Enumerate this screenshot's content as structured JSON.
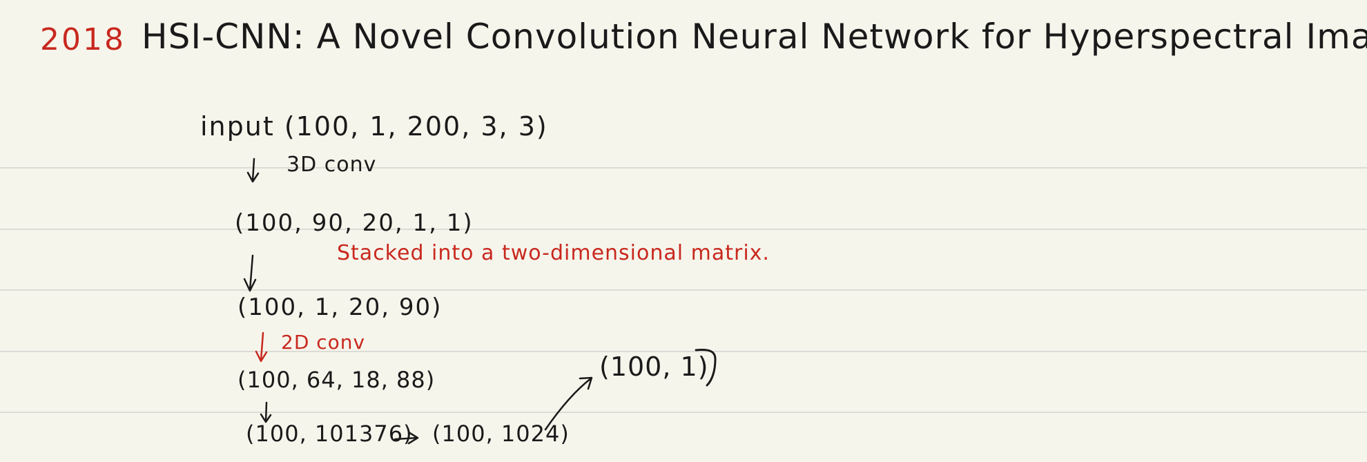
{
  "title": {
    "year": "2018",
    "text": "HSI-CNN: A Novel Convolution Neural Network for Hyperspectral Image."
  },
  "flow": {
    "input": "input (100, 1, 200, 3, 3)",
    "conv3d": "3D conv",
    "step1": "(100, 90, 20, 1, 1)",
    "note": "Stacked into a two-dimensional matrix.",
    "step2": "(100, 1, 20, 90)",
    "conv2d": "2D conv",
    "step3": "(100, 64, 18, 88)",
    "step4": "(100, 101376)",
    "step5": "(100, 1024)",
    "step6": "(100, 1)"
  },
  "colors": {
    "paper": "#f6f5ec",
    "rule": "#dcdcd6",
    "ink": "#1a1a1a",
    "red_ink": "#c8281e"
  }
}
